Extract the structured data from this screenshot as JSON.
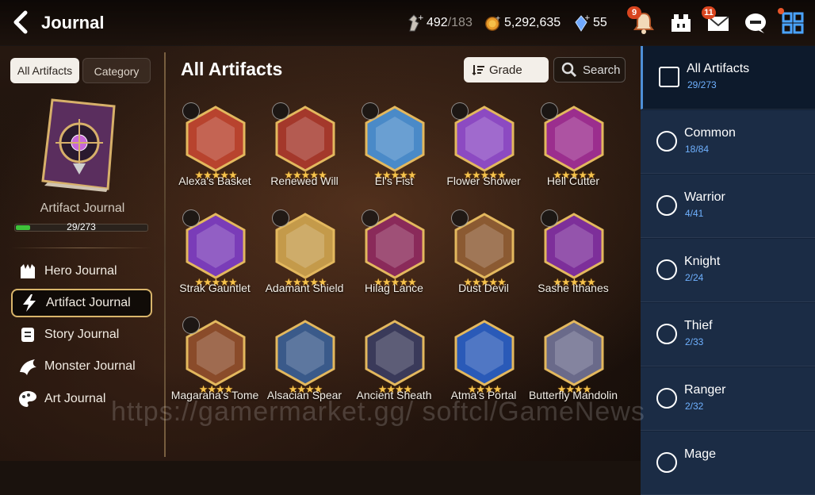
{
  "header": {
    "title": "Journal",
    "stamina_value": "492",
    "stamina_max": "/183",
    "gold": "5,292,635",
    "crystals": "55",
    "notification_badge": "9",
    "mail_badge": "11"
  },
  "left_panel": {
    "tab_all": "All Artifacts",
    "tab_category": "Category",
    "journal_name": "Artifact Journal",
    "progress_text": "29/273",
    "progress_fraction": 0.106,
    "nav": [
      {
        "label": "Hero Journal",
        "icon": "hero-journal-icon"
      },
      {
        "label": "Artifact Journal",
        "icon": "lightning-icon"
      },
      {
        "label": "Story Journal",
        "icon": "scroll-icon"
      },
      {
        "label": "Monster Journal",
        "icon": "dragon-icon"
      },
      {
        "label": "Art Journal",
        "icon": "palette-icon"
      }
    ]
  },
  "main": {
    "title": "All Artifacts",
    "grade_button": "Grade",
    "search_button": "Search",
    "artifacts": [
      {
        "name": "Alexa's Basket",
        "stars": "★★★★★",
        "color": "#b8432e",
        "icon": "thief-class-icon"
      },
      {
        "name": "Renewed Will",
        "stars": "★★★★★",
        "color": "#a4382b",
        "icon": "ranger-class-icon"
      },
      {
        "name": "El's Fist",
        "stars": "★★★★★",
        "color": "#4a8ac8",
        "icon": "warrior-class-icon"
      },
      {
        "name": "Flower Shower",
        "stars": "★★★★★",
        "color": "#8c4ac2",
        "icon": "warrior-class-icon"
      },
      {
        "name": "Hell Cutter",
        "stars": "★★★★★",
        "color": "#9b2e8e",
        "icon": "warrior-class-icon"
      },
      {
        "name": "Strak Gauntlet",
        "stars": "★★★★★",
        "color": "#7a3cb8",
        "icon": "warrior-class-icon"
      },
      {
        "name": "Adamant Shield",
        "stars": "★★★★★",
        "color": "#c49a4a",
        "icon": "knight-class-icon"
      },
      {
        "name": "Hilag Lance",
        "stars": "★★★★★",
        "color": "#8a2a5a",
        "icon": "knight-class-icon"
      },
      {
        "name": "Dust Devil",
        "stars": "★★★★★",
        "color": "#8b5a32",
        "icon": "thief-class-icon"
      },
      {
        "name": "Sashe Ithanes",
        "stars": "★★★★★",
        "color": "#7d2f9a",
        "icon": "ranger-class-icon"
      },
      {
        "name": "Magaraha's Tome",
        "stars": "★★★★",
        "color": "#8a4b2a",
        "icon": "mage-class-icon"
      },
      {
        "name": "Alsacian Spear",
        "stars": "★★★★",
        "color": "#3a5a8a",
        "icon": ""
      },
      {
        "name": "Ancient Sheath",
        "stars": "★★★★",
        "color": "#3a3a5a",
        "icon": ""
      },
      {
        "name": "Atma's Portal",
        "stars": "★★★★",
        "color": "#2a5ab8",
        "icon": ""
      },
      {
        "name": "Butterfly Mandolin",
        "stars": "★★★★",
        "color": "#6a6a8a",
        "icon": ""
      }
    ]
  },
  "categories": [
    {
      "name": "All Artifacts",
      "count": "29/273",
      "icon": "all-icon"
    },
    {
      "name": "Common",
      "count": "18/84",
      "icon": "common-class-icon"
    },
    {
      "name": "Warrior",
      "count": "4/41",
      "icon": "warrior-class-icon"
    },
    {
      "name": "Knight",
      "count": "2/24",
      "icon": "knight-class-icon"
    },
    {
      "name": "Thief",
      "count": "2/33",
      "icon": "thief-class-icon"
    },
    {
      "name": "Ranger",
      "count": "2/32",
      "icon": "ranger-class-icon"
    },
    {
      "name": "Mage",
      "count": "",
      "icon": "mage-class-icon"
    }
  ],
  "watermark": "https://gamermarket.gg/ softcl/GameNews"
}
